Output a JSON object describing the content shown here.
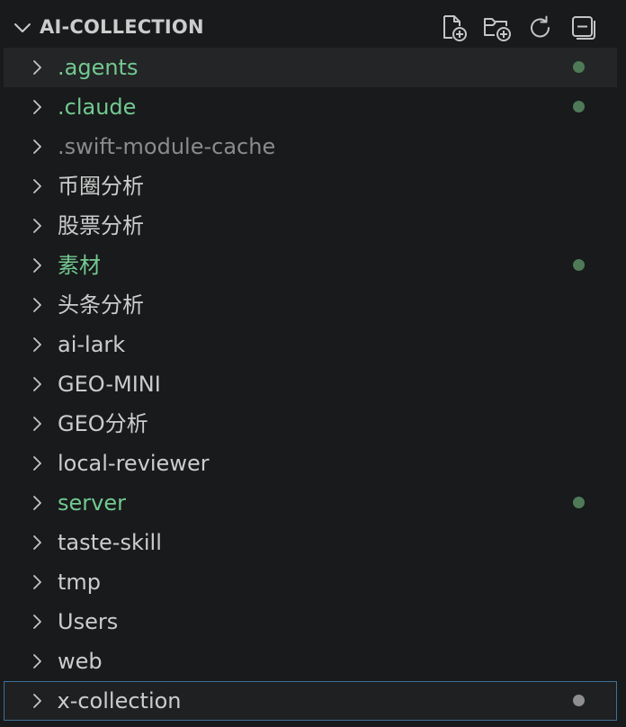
{
  "explorer": {
    "title": "AI-COLLECTION",
    "actions": [
      {
        "name": "new-file-button",
        "icon": "new-file-icon",
        "label": "New File..."
      },
      {
        "name": "new-folder-button",
        "icon": "new-folder-icon",
        "label": "New Folder..."
      },
      {
        "name": "refresh-button",
        "icon": "refresh-icon",
        "label": "Refresh Explorer"
      },
      {
        "name": "collapse-all-button",
        "icon": "collapse-all-icon",
        "label": "Collapse Folders in Explorer"
      }
    ]
  },
  "colors": {
    "default": "#cccccc",
    "modified": "#73c991",
    "ignored": "#8b8b8b",
    "modified_dot": "#4e7a58",
    "selected_dot": "#8e8e8e",
    "selected_border": "#3e6f96"
  },
  "tree": {
    "items": [
      {
        "label": ".agents",
        "status": "modified",
        "dot": true
      },
      {
        "label": ".claude",
        "status": "modified",
        "dot": true
      },
      {
        "label": ".swift-module-cache",
        "status": "ignored",
        "dot": false
      },
      {
        "label": "币圈分析",
        "status": "default",
        "dot": false
      },
      {
        "label": "股票分析",
        "status": "default",
        "dot": false
      },
      {
        "label": "素材",
        "status": "modified",
        "dot": true
      },
      {
        "label": "头条分析",
        "status": "default",
        "dot": false
      },
      {
        "label": "ai-lark",
        "status": "default",
        "dot": false
      },
      {
        "label": "GEO-MINI",
        "status": "default",
        "dot": false
      },
      {
        "label": "GEO分析",
        "status": "default",
        "dot": false
      },
      {
        "label": "local-reviewer",
        "status": "default",
        "dot": false
      },
      {
        "label": "server",
        "status": "modified",
        "dot": true
      },
      {
        "label": "taste-skill",
        "status": "default",
        "dot": false
      },
      {
        "label": "tmp",
        "status": "default",
        "dot": false
      },
      {
        "label": "Users",
        "status": "default",
        "dot": false
      },
      {
        "label": "web",
        "status": "default",
        "dot": false
      },
      {
        "label": "x-collection",
        "status": "default",
        "dot": true,
        "selected": true
      }
    ]
  }
}
